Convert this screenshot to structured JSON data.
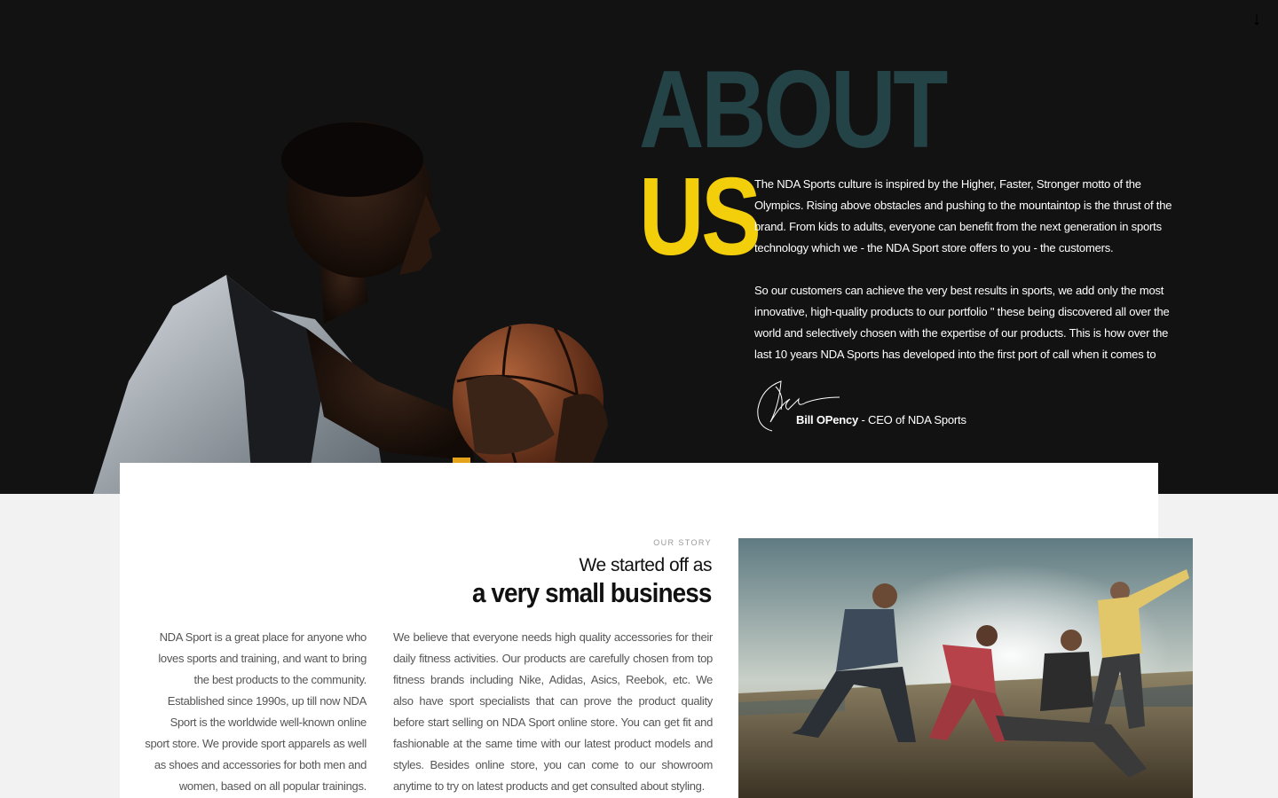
{
  "hero": {
    "title_line1": "ABOUT",
    "title_line2": "US",
    "scroll_icon": "arrow-down-icon",
    "paragraphs": [
      "The NDA Sports culture is inspired by the Higher, Faster, Stronger motto of the Olympics. Rising above obstacles and pushing to the mountaintop is the thrust of the brand. From kids to adults, everyone can benefit from the next generation in sports technology which we - the NDA Sport store offers to you - the customers.",
      "So our customers can achieve the very best results in sports, we add only the most innovative, high-quality products to our portfolio \" these being discovered all over the world and selectively chosen with the expertise of our products. This is how over the last 10 years NDA Sports has developed into the first port of call when it comes to"
    ],
    "signer_name": "Bill OPency",
    "signer_role": " - CEO of NDA Sports"
  },
  "story": {
    "eyebrow": "OUR STORY",
    "heading_line1": "We started off as",
    "heading_line2": "a very small business",
    "col_left": "NDA Sport is a great place for anyone who loves sports and training, and want to bring the best products to the community. Established since 1990s, up till now NDA Sport is the worldwide well-known online sport store. We provide sport apparels as well as shoes and accessories for both men and women, based on all popular trainings.",
    "col_right": "We believe that everyone needs high quality accessories for their daily fitness activities. Our products are carefully chosen from top fitness brands including Nike, Adidas, Asics, Reebok, etc. We also have sport specialists that can prove the product quality before start selling on NDA Sport online store. You can get fit and fashionable at the same time with our latest product models and styles. Besides online store, you can come to our showroom anytime  to try on latest products and get consulted about styling."
  },
  "colors": {
    "hero_bg": "#121212",
    "about_color": "#244347",
    "us_color": "#f3cf0b"
  }
}
